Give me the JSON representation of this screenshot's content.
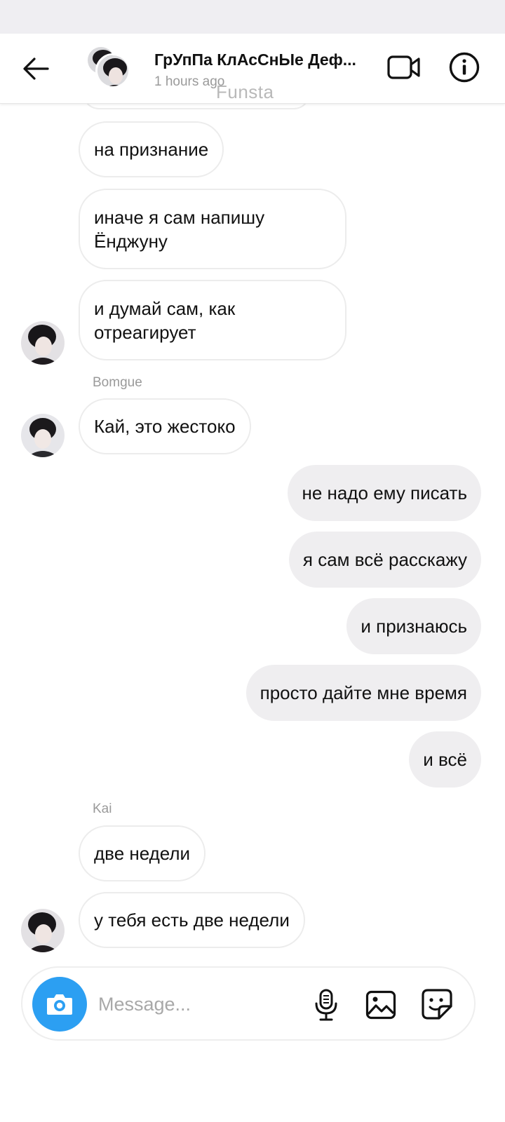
{
  "header": {
    "title": "ГрУпПа КлАсСнЫе Деф...",
    "subtitle": "1 hours ago",
    "watermark": "Funsta"
  },
  "messages": [
    {
      "text": "на признание"
    },
    {
      "text": "иначе я сам напишу Ёнджуну"
    },
    {
      "text": "и думай сам, как отреагирует"
    },
    {
      "sender": "Bomgue"
    },
    {
      "text": "Кай, это жестоко"
    },
    {
      "text": "не надо ему писать"
    },
    {
      "text": "я сам всё расскажу"
    },
    {
      "text": "и признаюсь"
    },
    {
      "text": "просто дайте мне время"
    },
    {
      "text": "и всё"
    },
    {
      "sender": "Kai"
    },
    {
      "text": "две недели"
    },
    {
      "text": "у тебя есть две недели"
    }
  ],
  "composer": {
    "placeholder": "Message..."
  },
  "icons": {
    "back": "arrow-left-icon",
    "video": "video-camera-icon",
    "info": "info-icon",
    "camera": "camera-icon",
    "mic": "microphone-icon",
    "gallery": "image-icon",
    "sticker": "sticker-icon"
  },
  "colors": {
    "accent": "#2c9ff2",
    "outgoing_bubble": "#efeef0",
    "incoming_border": "#ececec"
  }
}
